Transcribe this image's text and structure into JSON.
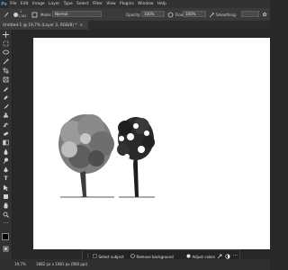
{
  "menu": {
    "app_logo": "Ps",
    "items": [
      "File",
      "Edit",
      "Image",
      "Layer",
      "Type",
      "Select",
      "Filter",
      "View",
      "Plugins",
      "Window",
      "Help"
    ]
  },
  "options": {
    "brush_size": "1",
    "brush_sample": "1,182",
    "mode_label": "Mode:",
    "mode_value": "Normal",
    "opacity_label": "Opacity:",
    "opacity_value": "100%",
    "flow_label": "Flow:",
    "flow_value": "100%",
    "smoothing_label": "Smoothing:"
  },
  "document": {
    "tab_title": "Untitled-1 @ 19,7% (Layer 2, RGB/8) *",
    "close_label": "×"
  },
  "status": {
    "zoom": "19,7%",
    "info": "1882 px x 1981 px (300 ppi)"
  },
  "context_bar": {
    "select_subject": "Select subject",
    "remove_background": "Remove background",
    "adjust_colors": "Adjust colors"
  },
  "colors": {
    "menubar_bg": "#323232",
    "panel_bg": "#282828",
    "canvas_bg": "#ffffff",
    "accent": "#4fa3ff"
  },
  "icons": [
    "brush-icon",
    "move-icon",
    "marquee-icon",
    "lasso-icon",
    "crop-icon",
    "eyedropper-icon",
    "healing-icon",
    "brush-tool-icon",
    "stamp-icon",
    "history-brush-icon",
    "eraser-icon",
    "gradient-icon",
    "blur-icon",
    "dodge-icon",
    "pen-icon",
    "type-icon",
    "path-select-icon",
    "shape-icon",
    "hand-icon",
    "zoom-icon"
  ]
}
